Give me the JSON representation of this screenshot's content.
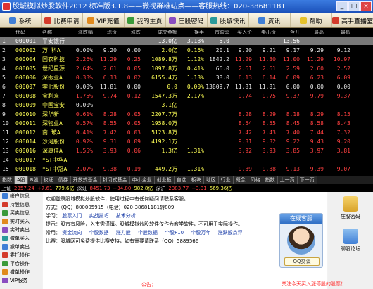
{
  "window": {
    "title": "股城模拟炒股软件2012  标准版3.1.8——微视群雄站点——客服热线：020-38681181",
    "min": "_",
    "max": "□",
    "close": "×"
  },
  "menu": [
    {
      "label": "系统",
      "icon": "gear-icon",
      "color": "blue"
    },
    {
      "label": "比赛申请",
      "icon": "flag-icon",
      "color": "red"
    },
    {
      "label": "VIP充值",
      "icon": "card-icon",
      "color": "orange"
    },
    {
      "label": "我的主页",
      "icon": "home-icon",
      "color": "green"
    },
    {
      "label": "庄股密码",
      "icon": "lock-icon",
      "color": "purple"
    },
    {
      "label": "股城快讯",
      "icon": "news-icon",
      "color": "teal"
    },
    {
      "label": "资讯",
      "icon": "info-icon",
      "color": "blue"
    },
    {
      "label": "帮助",
      "icon": "help-icon",
      "color": "yellow"
    },
    {
      "label": "高手直播室",
      "icon": "live-icon",
      "color": "red"
    }
  ],
  "table": {
    "headers": [
      "",
      "代码",
      "名称",
      "涨跌幅",
      "现价",
      "涨跌",
      "成交金额",
      "换手",
      "市盈率",
      "买入价",
      "卖出价",
      "今开",
      "最高",
      "最低"
    ],
    "rows": [
      [
        "1",
        "000001",
        "平安银行",
        "",
        "",
        "",
        "13.0亿",
        "3.18%",
        "5.0",
        "",
        "",
        "13.56",
        "",
        ""
      ],
      [
        "2",
        "000002",
        "万 科A",
        "0.00%",
        "9.20",
        "0.00",
        "2.0亿",
        "0.16%",
        "20.1",
        "9.20",
        "9.21",
        "9.17",
        "9.29",
        "9.12"
      ],
      [
        "3",
        "000004",
        "国农科技",
        "2.26%",
        "11.29",
        "0.25",
        "1089.8万",
        "1.12%",
        "1842.2",
        "11.29",
        "11.30",
        "11.00",
        "11.29",
        "10.97"
      ],
      [
        "4",
        "000005",
        "世纪星源",
        "2.64%",
        "2.61",
        "0.05",
        "1097.8万",
        "0.41%",
        "66.0",
        "2.61",
        "2.61",
        "2.59",
        "2.60",
        "2.52"
      ],
      [
        "5",
        "000006",
        "深振业A",
        "0.33%",
        "6.13",
        "0.02",
        "6155.4万",
        "1.13%",
        "38.0",
        "6.13",
        "6.14",
        "6.09",
        "6.23",
        "6.09"
      ],
      [
        "6",
        "000007",
        "零七股份",
        "0.00%",
        "11.81",
        "0.00",
        "0.0",
        "0.00%",
        "13809.7",
        "11.81",
        "11.81",
        "0.00",
        "0.00",
        "0.00"
      ],
      [
        "7",
        "000008",
        "宝利来",
        "1.75%",
        "9.74",
        "0.12",
        "1547.3万",
        "2.17%",
        "",
        "9.74",
        "9.75",
        "9.37",
        "9.79",
        "9.37"
      ],
      [
        "8",
        "000009",
        "中国宝安",
        "0.00%",
        "",
        "",
        "3.1亿",
        "",
        "",
        "",
        "",
        "",
        "",
        ""
      ],
      [
        "9",
        "000010",
        "深华新",
        "0.61%",
        "8.28",
        "0.05",
        "2207.7万",
        "",
        "",
        "8.28",
        "8.29",
        "8.18",
        "8.29",
        "8.15"
      ],
      [
        "10",
        "000011",
        "深物业A",
        "0.57%",
        "8.55",
        "0.05",
        "1958.0万",
        "",
        "",
        "8.54",
        "8.55",
        "8.45",
        "8.58",
        "8.43"
      ],
      [
        "11",
        "000012",
        "南 玻A",
        "0.41%",
        "7.42",
        "0.03",
        "5123.8万",
        "",
        "",
        "7.42",
        "7.43",
        "7.40",
        "7.44",
        "7.32"
      ],
      [
        "12",
        "000014",
        "沙河股份",
        "0.92%",
        "9.31",
        "0.09",
        "4192.1万",
        "",
        "",
        "9.31",
        "9.32",
        "9.22",
        "9.43",
        "9.20"
      ],
      [
        "13",
        "000016",
        "深康佳A",
        "1.55%",
        "3.93",
        "0.06",
        "1.3亿",
        "1.31%",
        "",
        "3.92",
        "3.93",
        "3.85",
        "3.97",
        "3.81"
      ],
      [
        "14",
        "000017",
        "*ST中华A",
        "",
        "",
        "",
        "",
        "",
        "",
        "",
        "",
        "",
        "",
        ""
      ],
      [
        "15",
        "000018",
        "*ST中冠A",
        "2.07%",
        "9.38",
        "0.19",
        "449.2万",
        "1.31%",
        "",
        "9.39",
        "9.38",
        "9.13",
        "9.39",
        "9.07"
      ]
    ]
  },
  "tabs": [
    "指数",
    "A股",
    "B股",
    "权证",
    "债券",
    "开放式基金",
    "封闭式基金",
    "中小企业",
    "创业板",
    "自选",
    "板块",
    "地区",
    "行业",
    "概念",
    "风格",
    "指数",
    "上一页",
    "下一页"
  ],
  "ticker": [
    {
      "label": "上证",
      "value": "2357.24",
      "change": "+7.61",
      "amount": "779.6亿"
    },
    {
      "label": "深证",
      "value": "8451.73",
      "change": "+34.80",
      "amount": "982.8亿"
    },
    {
      "label": "深沪",
      "value": "2383.77",
      "change": "+3.31",
      "amount": "569.36亿"
    }
  ],
  "nav": [
    "帐户信息",
    "持股信息",
    "买卖信息",
    "实时买入",
    "实时卖出",
    "撤单买入",
    "撤单卖出",
    "委托操作",
    "平仓操作",
    "撤单操作",
    "VIP服务"
  ],
  "welcome": {
    "line1": "欢迎登录股城模拟炒股软件，使用过程中有任何疑问请联系客服。",
    "line2": "方式：（QQ）800005915（电话）020-38681181转809",
    "line3_label": "学习：",
    "line3_links": [
      "股票入门",
      "实战技巧",
      "技术分析"
    ],
    "line4": "提示：股市有风险，入市需谨慎。股城模拟炒股软件仅作为教学软件，不可用于实际操作。",
    "line5_label": "常用：",
    "line5_links": [
      "资金流向",
      "个股数据",
      "涨力股",
      "个股数据",
      "个股F10",
      "个股万年",
      "涨跌股点评"
    ],
    "line6": "比赛：股城网可免费提供比赛支持，如有需要请联系（QQ）5889566",
    "notice": "公告："
  },
  "service": {
    "title": "在线客服",
    "qq_label": "QQ交谈"
  },
  "right": {
    "item1": "庄股密码",
    "item2": "聊股论坛",
    "buy_note": "关注今天买入涨停股的股票！"
  }
}
